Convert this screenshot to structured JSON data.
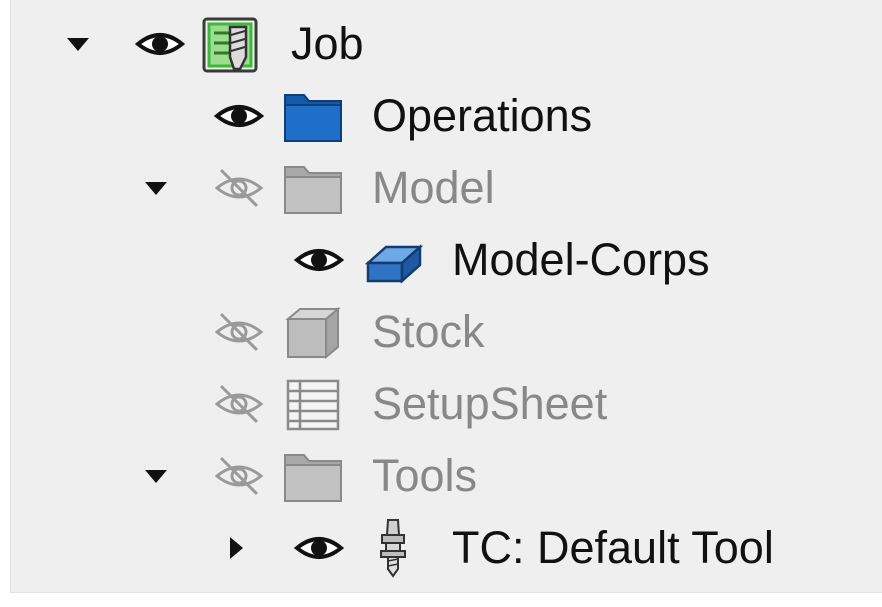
{
  "tree": {
    "items": [
      {
        "label": "Job",
        "icon": "job-icon",
        "visible": true,
        "expander": "expanded"
      },
      {
        "label": "Operations",
        "icon": "folder-blue-icon",
        "visible": true,
        "expander": "none"
      },
      {
        "label": "Model",
        "icon": "folder-gray-icon",
        "visible": false,
        "expander": "expanded"
      },
      {
        "label": "Model-Corps",
        "icon": "solid-body-icon",
        "visible": true,
        "expander": "none"
      },
      {
        "label": "Stock",
        "icon": "stock-cube-icon",
        "visible": false,
        "expander": "none"
      },
      {
        "label": "SetupSheet",
        "icon": "setup-sheet-icon",
        "visible": false,
        "expander": "none"
      },
      {
        "label": "Tools",
        "icon": "folder-gray-icon",
        "visible": false,
        "expander": "expanded"
      },
      {
        "label": "TC: Default Tool",
        "icon": "tool-controller-icon",
        "visible": true,
        "expander": "collapsed"
      }
    ]
  },
  "colors": {
    "panel_bg": "#efefef",
    "text": "#111111",
    "text_hidden": "#888888",
    "folder_blue": "#1f6fc8",
    "job_green": "#3cb83c"
  }
}
